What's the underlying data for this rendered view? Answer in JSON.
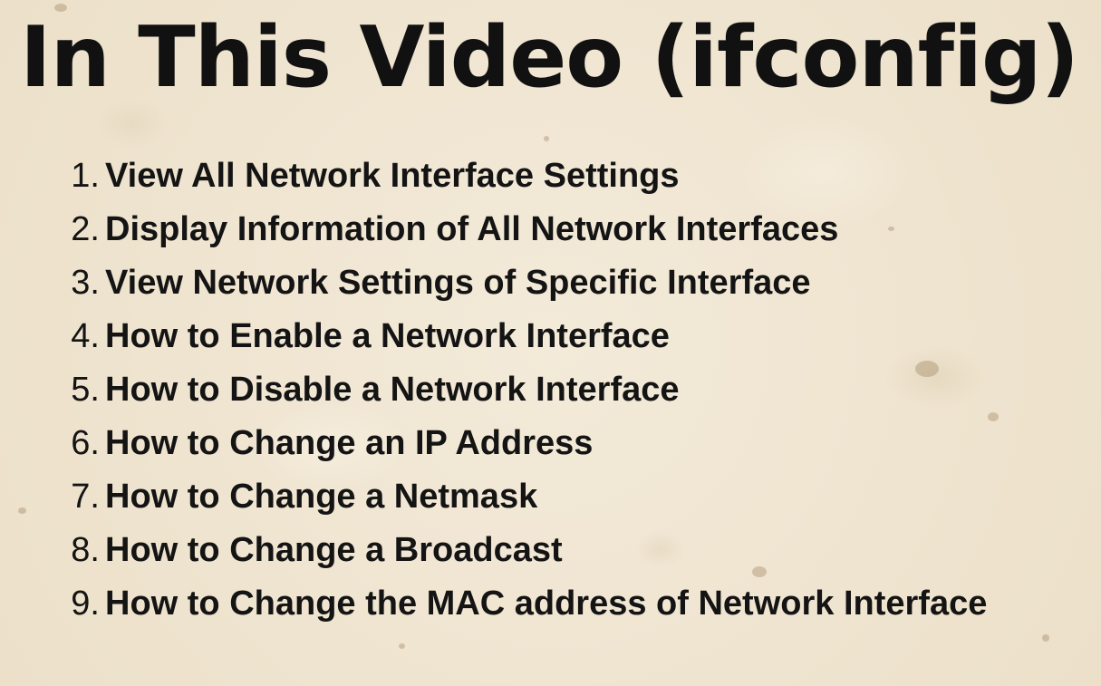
{
  "title": "In This Video (ifconfig)",
  "topics": [
    {
      "number": "1.",
      "label": "View All Network Interface Settings"
    },
    {
      "number": "2.",
      "label": "Display Information of All Network Interfaces"
    },
    {
      "number": "3.",
      "label": "View Network Settings of Specific Interface"
    },
    {
      "number": "4.",
      "label": "How to Enable a Network Interface"
    },
    {
      "number": "5.",
      "label": "How to Disable a Network Interface"
    },
    {
      "number": "6.",
      "label": "How to Change an IP Address"
    },
    {
      "number": "7.",
      "label": "How to Change a Netmask"
    },
    {
      "number": "8.",
      "label": "How to Change a Broadcast"
    },
    {
      "number": "9.",
      "label": "How to Change the MAC address of Network Interface"
    }
  ]
}
